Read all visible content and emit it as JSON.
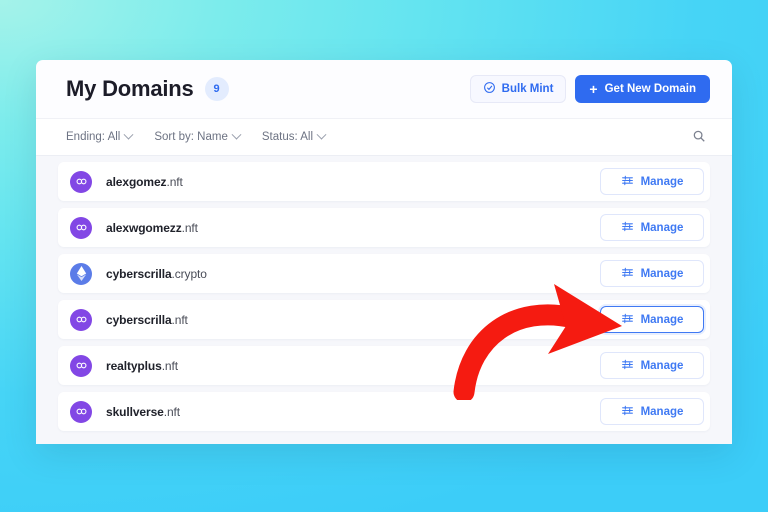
{
  "background": {
    "gradient_from": "#a5f3ea",
    "gradient_to": "#3ccdf8"
  },
  "header": {
    "title": "My Domains",
    "count_badge": "9",
    "badge_color": "#2f6bf0",
    "bulk_mint_label": "Bulk Mint",
    "bulk_mint_icon": "check-circle-icon",
    "get_new_domain_label": "Get New Domain",
    "get_new_domain_icon": "plus-icon",
    "primary_color": "#2f6bf0"
  },
  "filter_bar": {
    "filters": [
      {
        "label": "Ending: All",
        "icon": "chevron-down-icon"
      },
      {
        "label": "Sort by: Name",
        "icon": "chevron-down-icon"
      },
      {
        "label": "Status: All",
        "icon": "chevron-down-icon"
      }
    ],
    "search_icon": "search-icon"
  },
  "domain_list": {
    "manage_label": "Manage",
    "manage_icon": "sliders-icon",
    "rows": [
      {
        "name": "alexgomez",
        "ext": ".nft",
        "chain": "polygon",
        "chain_icon": "polygon-icon",
        "chain_color": "#8247e5",
        "highlighted": false
      },
      {
        "name": "alexwgomezz",
        "ext": ".nft",
        "chain": "polygon",
        "chain_icon": "polygon-icon",
        "chain_color": "#8247e5",
        "highlighted": false
      },
      {
        "name": "cyberscrilla",
        "ext": ".crypto",
        "chain": "ethereum",
        "chain_icon": "ethereum-icon",
        "chain_color": "#5b7ce8",
        "highlighted": false
      },
      {
        "name": "cyberscrilla",
        "ext": ".nft",
        "chain": "polygon",
        "chain_icon": "polygon-icon",
        "chain_color": "#8247e5",
        "highlighted": true
      },
      {
        "name": "realtyplus",
        "ext": ".nft",
        "chain": "polygon",
        "chain_icon": "polygon-icon",
        "chain_color": "#8247e5",
        "highlighted": false
      },
      {
        "name": "skullverse",
        "ext": ".nft",
        "chain": "polygon",
        "chain_icon": "polygon-icon",
        "chain_color": "#8247e5",
        "highlighted": false
      }
    ]
  },
  "annotation": {
    "type": "curved-arrow",
    "color": "#f51b11",
    "points_to": "manage-button-row-4"
  }
}
